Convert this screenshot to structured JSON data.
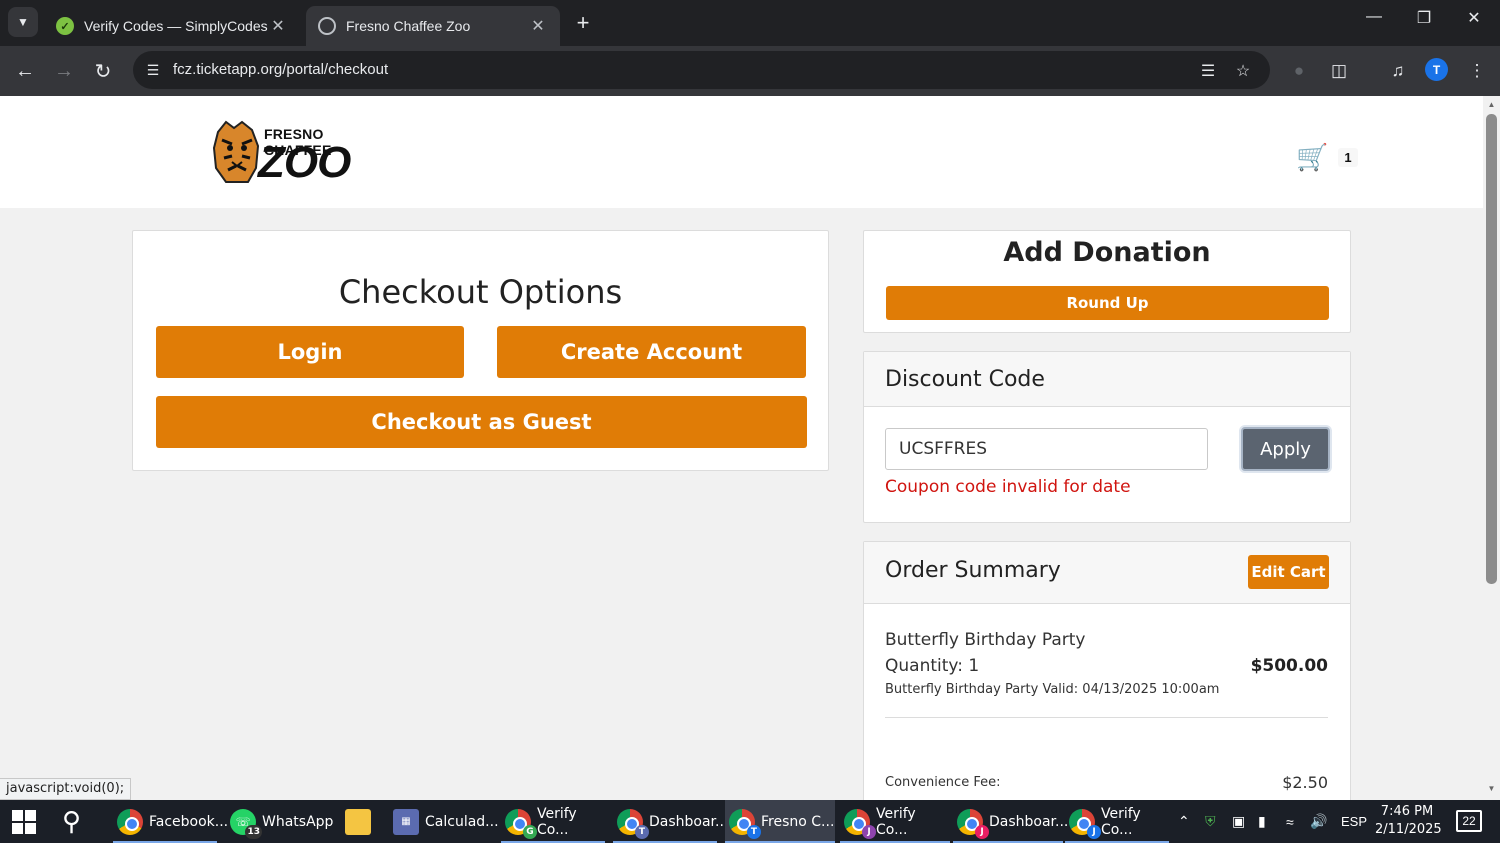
{
  "browser": {
    "tabs": [
      {
        "title": "Verify Codes — SimplyCodes",
        "favicon": "simplycodes-icon",
        "active": false
      },
      {
        "title": "Fresno Chaffee Zoo",
        "favicon": "globe-icon",
        "active": true
      }
    ],
    "url": "fcz.ticketapp.org/portal/checkout",
    "status_text": "javascript:void(0);",
    "profile_initial": "T"
  },
  "site": {
    "logo_top": "FRESNO CHAFFEE",
    "logo_main": "ZOO",
    "cart_count": "1"
  },
  "checkout": {
    "title": "Checkout Options",
    "login_label": "Login",
    "create_account_label": "Create Account",
    "guest_label": "Checkout as Guest"
  },
  "donation": {
    "title": "Add Donation",
    "round_up_label": "Round Up"
  },
  "discount": {
    "title": "Discount Code",
    "code_value": "UCSFFRES",
    "apply_label": "Apply",
    "error": "Coupon code invalid for date"
  },
  "summary": {
    "title": "Order Summary",
    "edit_cart_label": "Edit Cart",
    "item_name": "Butterfly Birthday Party",
    "item_quantity": "Quantity: 1",
    "item_price": "$500.00",
    "item_valid": "Butterfly Birthday Party Valid: 04/13/2025 10:00am",
    "fee_label": "Convenience Fee:",
    "fee_value": "$2.50"
  },
  "taskbar": {
    "items": [
      {
        "label": "Facebook...",
        "icon": "chrome-icon"
      },
      {
        "label": "WhatsApp",
        "icon": "whatsapp-icon",
        "badge": "13"
      },
      {
        "label": "",
        "icon": "file-explorer-icon"
      },
      {
        "label": "Calculad...",
        "icon": "calculator-icon"
      },
      {
        "label": "Verify Co...",
        "icon": "chrome-icon",
        "badge": "G"
      },
      {
        "label": "Dashboar...",
        "icon": "chrome-icon",
        "badge": "T"
      },
      {
        "label": "Fresno C...",
        "icon": "chrome-icon",
        "badge": "T"
      },
      {
        "label": "Verify Co...",
        "icon": "chrome-icon",
        "badge": "J"
      },
      {
        "label": "Dashboar...",
        "icon": "chrome-icon",
        "badge": "J"
      },
      {
        "label": "Verify Co...",
        "icon": "chrome-icon",
        "badge": "J"
      }
    ],
    "language": "ESP",
    "time": "7:46 PM",
    "date": "2/11/2025",
    "notification_count": "22"
  },
  "colors": {
    "accent_orange": "#e07c06",
    "error_red": "#d0140f",
    "apply_gray": "#5b6470"
  }
}
